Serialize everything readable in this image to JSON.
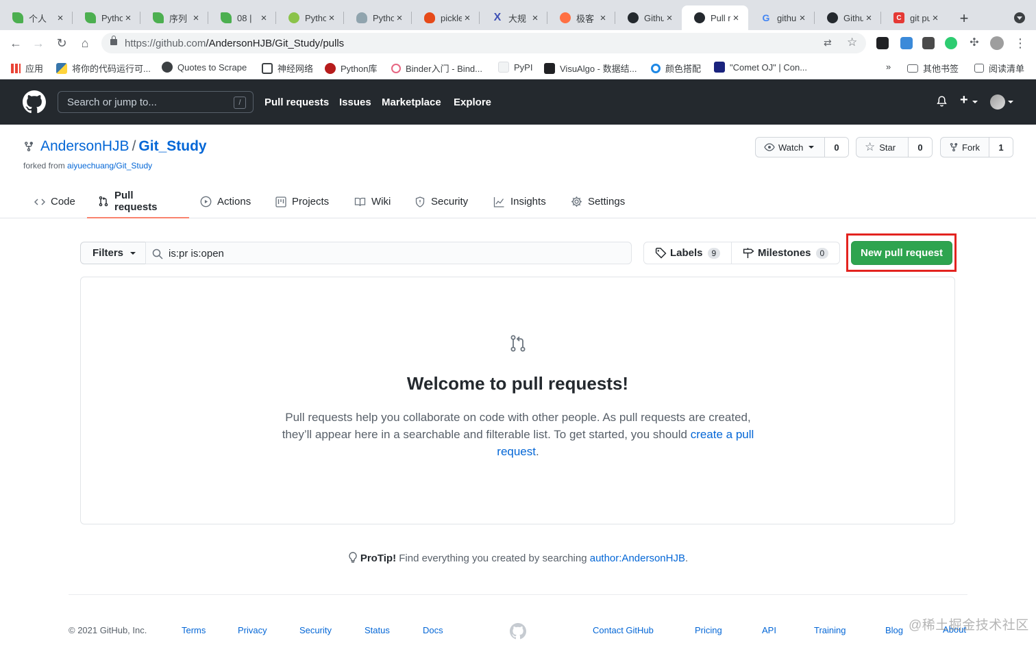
{
  "browser": {
    "tabs": [
      {
        "title": "个人",
        "icon": "leaf-icon",
        "color": "#4caf50"
      },
      {
        "title": "Pytho",
        "icon": "leaf-icon",
        "color": "#4caf50"
      },
      {
        "title": "序列",
        "icon": "leaf-icon",
        "color": "#4caf50"
      },
      {
        "title": "08 |",
        "icon": "leaf-icon",
        "color": "#4caf50"
      },
      {
        "title": "Pytho",
        "icon": "python-site-icon",
        "color": "#8bc34a"
      },
      {
        "title": "Pytho",
        "icon": "bulb-icon",
        "color": "#607d8b"
      },
      {
        "title": "pickle",
        "icon": "flame-icon",
        "color": "#e64a19"
      },
      {
        "title": "大规",
        "icon": "x-logo-icon",
        "color": "#3f51b5"
      },
      {
        "title": "极客",
        "icon": "geek-icon",
        "color": "#ff7043"
      },
      {
        "title": "Githu",
        "icon": "github-icon",
        "color": "#24292e"
      },
      {
        "title": "Pull r",
        "icon": "github-icon",
        "color": "#24292e",
        "active": true
      },
      {
        "title": "githu",
        "icon": "google-icon",
        "color": "#4285f4"
      },
      {
        "title": "Githu",
        "icon": "github-icon",
        "color": "#24292e"
      },
      {
        "title": "git pu",
        "icon": "csdn-icon",
        "color": "#e53935"
      }
    ],
    "url_host": "https://github.com",
    "url_path": "/AndersonHJB/Git_Study/pulls",
    "bookmarks": [
      {
        "label": "应用",
        "icon": "apps-grid-icon"
      },
      {
        "label": "将你的代码运行可...",
        "icon": "python-icon"
      },
      {
        "label": "Quotes to Scrape",
        "icon": "globe-icon"
      },
      {
        "label": "神经网络",
        "icon": "spiral-icon"
      },
      {
        "label": "Python库",
        "icon": "x-circle-icon"
      },
      {
        "label": "Binder入门 - Bind...",
        "icon": "binder-icon"
      },
      {
        "label": "PyPI",
        "icon": "page-icon"
      },
      {
        "label": "VisuAlgo - 数据结...",
        "icon": "visualgo-icon"
      },
      {
        "label": "颜色搭配",
        "icon": "color-circle-icon"
      },
      {
        "label": "\"Comet OJ\" | Con...",
        "icon": "cometoj-icon"
      }
    ],
    "bookmarks_more": "»",
    "other_bookmarks": "其他书签",
    "reading_list": "阅读清单"
  },
  "header": {
    "search_placeholder": "Search or jump to...",
    "search_key": "/",
    "nav": [
      "Pull requests",
      "Issues",
      "Marketplace",
      "Explore"
    ]
  },
  "repo": {
    "owner": "AndersonHJB",
    "separator": "/",
    "name": "Git_Study",
    "forked_prefix": "forked from",
    "forked_from": "aiyuechuang/Git_Study",
    "watch": {
      "label": "Watch",
      "count": "0"
    },
    "star": {
      "label": "Star",
      "count": "0"
    },
    "fork": {
      "label": "Fork",
      "count": "1"
    },
    "tabs": [
      {
        "label": "Code",
        "icon": "code-icon"
      },
      {
        "label": "Pull requests",
        "icon": "pull-request-icon",
        "selected": true
      },
      {
        "label": "Actions",
        "icon": "play-icon"
      },
      {
        "label": "Projects",
        "icon": "project-icon"
      },
      {
        "label": "Wiki",
        "icon": "book-icon"
      },
      {
        "label": "Security",
        "icon": "shield-icon"
      },
      {
        "label": "Insights",
        "icon": "graph-icon"
      },
      {
        "label": "Settings",
        "icon": "gear-icon"
      }
    ]
  },
  "pulls": {
    "filters_label": "Filters",
    "search_value": "is:pr is:open",
    "labels": {
      "label": "Labels",
      "count": "9"
    },
    "milestones": {
      "label": "Milestones",
      "count": "0"
    },
    "new_pr": "New pull request",
    "blank_title": "Welcome to pull requests!",
    "blank_text": "Pull requests help you collaborate on code with other people. As pull requests are created, they’ll appear here in a searchable and filterable list. To get started, you should ",
    "blank_link": "create a pull request",
    "blank_end": ".",
    "protip_label": "ProTip!",
    "protip_text": " Find everything you created by searching ",
    "protip_link": "author:AndersonHJB",
    "protip_end": "."
  },
  "footer": {
    "copyright": "© 2021 GitHub, Inc.",
    "left_links": [
      "Terms",
      "Privacy",
      "Security",
      "Status",
      "Docs"
    ],
    "right_links": [
      "Contact GitHub",
      "Pricing",
      "API",
      "Training",
      "Blog",
      "About"
    ],
    "watermark": "@稀土掘金技术社区"
  },
  "colors": {
    "primary_button": "#2ea44f",
    "highlight": "#e3231f",
    "link": "#0366d6",
    "header_bg": "#24292e",
    "selected_tab_underline": "#f9826c"
  }
}
